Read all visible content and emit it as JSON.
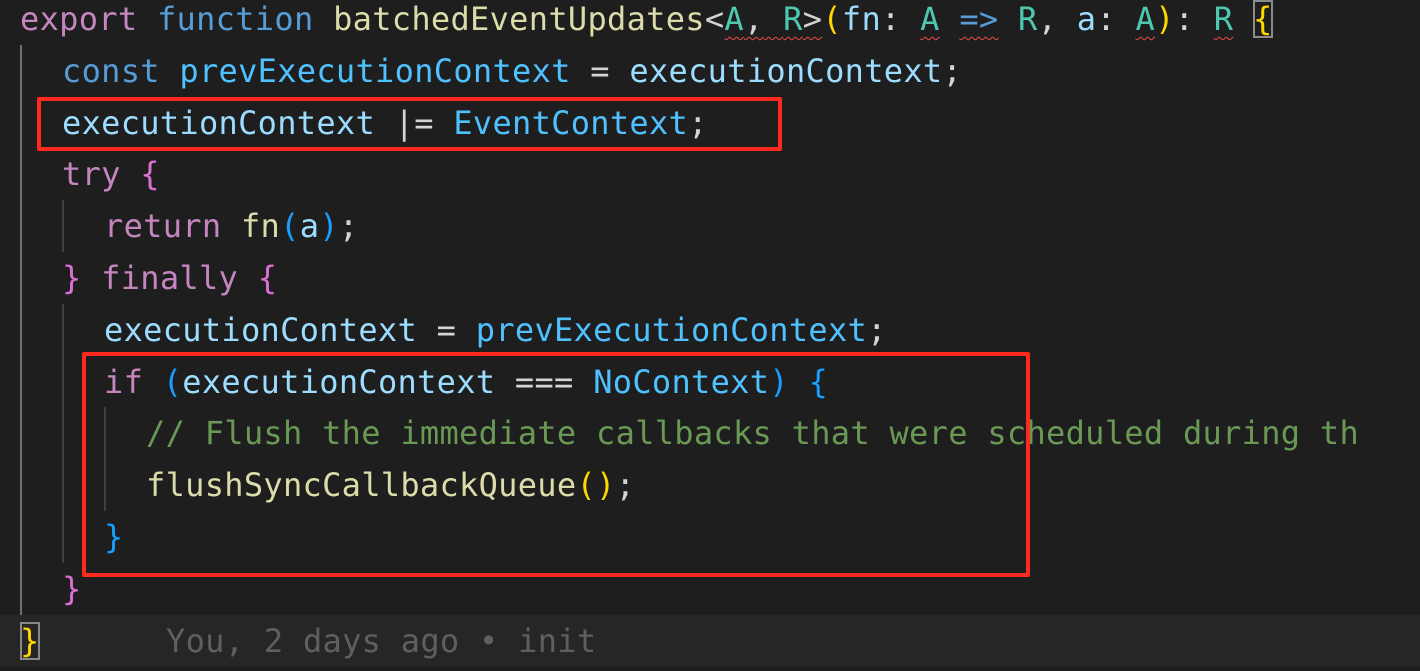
{
  "editor": {
    "colors": {
      "background": "#1e1e1e",
      "keyword": "#c586c0",
      "storage": "#569cd6",
      "function": "#dcdcaa",
      "variable": "#9cdcfe",
      "constant": "#4fc1ff",
      "type": "#4ec9b0",
      "comment": "#6a9955",
      "bracket_gold": "#ffd700",
      "bracket_purple": "#da70d6",
      "bracket_blue": "#179fff",
      "plain": "#d4d4d4",
      "highlight_box": "#ff2a1f"
    },
    "lines": [
      {
        "tokens": [
          {
            "text": "export",
            "role": "keyword"
          },
          {
            "text": " ",
            "role": "plain"
          },
          {
            "text": "function",
            "role": "storage"
          },
          {
            "text": " ",
            "role": "plain"
          },
          {
            "text": "batchedEventUpdates",
            "role": "function"
          },
          {
            "text": "<",
            "role": "plain"
          },
          {
            "text": "A",
            "role": "type",
            "squiggle": true
          },
          {
            "text": ",",
            "role": "plain",
            "squiggle": true
          },
          {
            "text": " ",
            "role": "plain",
            "squiggle": true
          },
          {
            "text": "R",
            "role": "type",
            "squiggle": true
          },
          {
            "text": ">",
            "role": "plain",
            "squiggle": true
          },
          {
            "text": "(",
            "role": "bracket_gold"
          },
          {
            "text": "fn",
            "role": "variable"
          },
          {
            "text": ": ",
            "role": "plain"
          },
          {
            "text": "A",
            "role": "type",
            "squiggle": true
          },
          {
            "text": " ",
            "role": "plain"
          },
          {
            "text": "=>",
            "role": "storage",
            "squiggle": true
          },
          {
            "text": " ",
            "role": "plain"
          },
          {
            "text": "R",
            "role": "type"
          },
          {
            "text": ", ",
            "role": "plain"
          },
          {
            "text": "a",
            "role": "variable"
          },
          {
            "text": ": ",
            "role": "plain"
          },
          {
            "text": "A",
            "role": "type",
            "squiggle": true
          },
          {
            "text": ")",
            "role": "bracket_gold"
          },
          {
            "text": ": ",
            "role": "plain"
          },
          {
            "text": "R",
            "role": "type",
            "squiggle": true
          },
          {
            "text": " ",
            "role": "plain"
          },
          {
            "text": "{",
            "role": "bracket_gold",
            "boxed": true
          }
        ]
      },
      {
        "tokens": [
          {
            "text": "const",
            "role": "storage"
          },
          {
            "text": " ",
            "role": "plain"
          },
          {
            "text": "prevExecutionContext",
            "role": "constant"
          },
          {
            "text": " = ",
            "role": "plain"
          },
          {
            "text": "executionContext",
            "role": "variable"
          },
          {
            "text": ";",
            "role": "plain"
          }
        ]
      },
      {
        "tokens": [
          {
            "text": "executionContext",
            "role": "variable"
          },
          {
            "text": " |= ",
            "role": "plain"
          },
          {
            "text": "EventContext",
            "role": "constant"
          },
          {
            "text": ";",
            "role": "plain"
          }
        ]
      },
      {
        "tokens": [
          {
            "text": "try",
            "role": "keyword"
          },
          {
            "text": " ",
            "role": "plain"
          },
          {
            "text": "{",
            "role": "bracket_purple"
          }
        ]
      },
      {
        "tokens": [
          {
            "text": "return",
            "role": "keyword"
          },
          {
            "text": " ",
            "role": "plain"
          },
          {
            "text": "fn",
            "role": "function"
          },
          {
            "text": "(",
            "role": "bracket_blue"
          },
          {
            "text": "a",
            "role": "variable"
          },
          {
            "text": ")",
            "role": "bracket_blue"
          },
          {
            "text": ";",
            "role": "plain"
          }
        ]
      },
      {
        "tokens": [
          {
            "text": "}",
            "role": "bracket_purple"
          },
          {
            "text": " ",
            "role": "plain"
          },
          {
            "text": "finally",
            "role": "keyword"
          },
          {
            "text": " ",
            "role": "plain"
          },
          {
            "text": "{",
            "role": "bracket_purple"
          }
        ]
      },
      {
        "tokens": [
          {
            "text": "executionContext",
            "role": "variable"
          },
          {
            "text": " = ",
            "role": "plain"
          },
          {
            "text": "prevExecutionContext",
            "role": "constant"
          },
          {
            "text": ";",
            "role": "plain"
          }
        ]
      },
      {
        "tokens": [
          {
            "text": "if",
            "role": "keyword"
          },
          {
            "text": " ",
            "role": "plain"
          },
          {
            "text": "(",
            "role": "bracket_blue"
          },
          {
            "text": "executionContext",
            "role": "variable"
          },
          {
            "text": " === ",
            "role": "plain"
          },
          {
            "text": "NoContext",
            "role": "constant"
          },
          {
            "text": ")",
            "role": "bracket_blue"
          },
          {
            "text": " ",
            "role": "plain"
          },
          {
            "text": "{",
            "role": "bracket_blue"
          }
        ]
      },
      {
        "tokens": [
          {
            "text": "// Flush the immediate callbacks that were scheduled during th",
            "role": "comment"
          }
        ]
      },
      {
        "tokens": [
          {
            "text": "flushSyncCallbackQueue",
            "role": "function"
          },
          {
            "text": "()",
            "role": "bracket_gold"
          },
          {
            "text": ";",
            "role": "plain"
          }
        ]
      },
      {
        "tokens": [
          {
            "text": "}",
            "role": "bracket_blue"
          }
        ]
      },
      {
        "tokens": [
          {
            "text": "}",
            "role": "bracket_purple"
          }
        ]
      },
      {
        "tokens": [
          {
            "text": "}",
            "role": "bracket_gold",
            "boxed": true
          }
        ],
        "blame": "You, 2 days ago • init",
        "current": true
      }
    ]
  }
}
